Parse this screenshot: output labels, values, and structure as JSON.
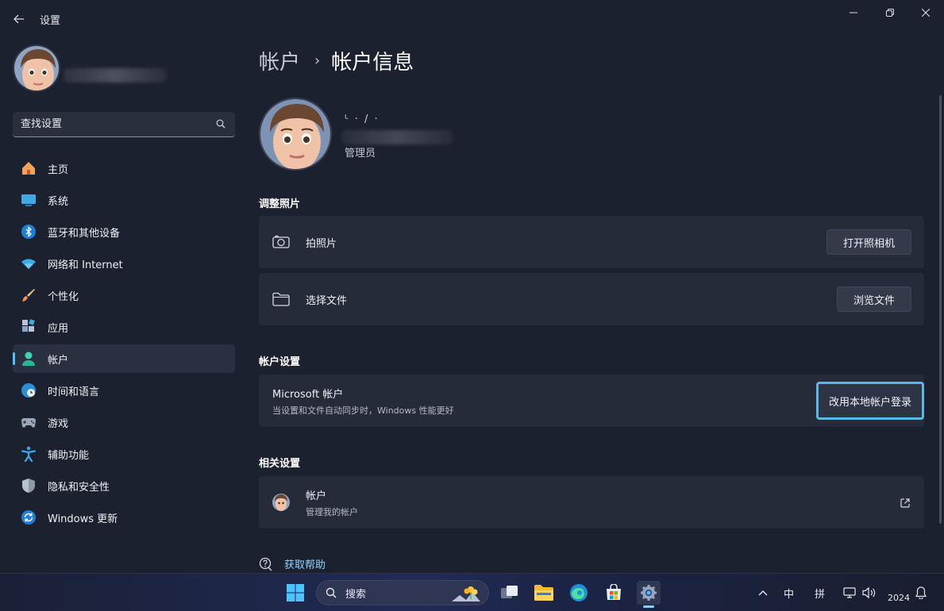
{
  "window": {
    "title": "设置"
  },
  "sidebar": {
    "search_placeholder": "查找设置",
    "items": [
      {
        "label": "主页",
        "icon": "home-icon"
      },
      {
        "label": "系统",
        "icon": "monitor-icon"
      },
      {
        "label": "蓝牙和其他设备",
        "icon": "bluetooth-icon"
      },
      {
        "label": "网络和 Internet",
        "icon": "wifi-icon"
      },
      {
        "label": "个性化",
        "icon": "paintbrush-icon"
      },
      {
        "label": "应用",
        "icon": "apps-icon"
      },
      {
        "label": "帐户",
        "icon": "person-icon",
        "active": true
      },
      {
        "label": "时间和语言",
        "icon": "globe-clock-icon"
      },
      {
        "label": "游戏",
        "icon": "gamepad-icon"
      },
      {
        "label": "辅助功能",
        "icon": "accessibility-icon"
      },
      {
        "label": "隐私和安全性",
        "icon": "shield-icon"
      },
      {
        "label": "Windows 更新",
        "icon": "update-icon"
      }
    ]
  },
  "main": {
    "breadcrumb": {
      "parent": "帐户",
      "separator": "›",
      "current": "帐户信息"
    },
    "account": {
      "name_fragment": "ᴸ · / ·",
      "role": "管理员"
    },
    "adjust_photo": {
      "title": "调整照片",
      "take_photo_label": "拍照片",
      "take_photo_button": "打开照相机",
      "choose_file_label": "选择文件",
      "choose_file_button": "浏览文件"
    },
    "account_settings": {
      "title": "帐户设置",
      "ms_title": "Microsoft 帐户",
      "ms_sub": "当设置和文件自动同步时，Windows 性能更好",
      "ms_button": "改用本地帐户登录"
    },
    "related": {
      "title": "相关设置",
      "item_title": "帐户",
      "item_sub": "管理我的帐户"
    },
    "help_label": "获取帮助"
  },
  "taskbar": {
    "search_label": "搜索",
    "ime_lang": "中",
    "ime_mode": "拼",
    "time": "2024"
  },
  "colors": {
    "accent": "#4cc2ff",
    "highlight_border": "#59b8e6",
    "background": "#1c2130",
    "card": "#262b39"
  }
}
